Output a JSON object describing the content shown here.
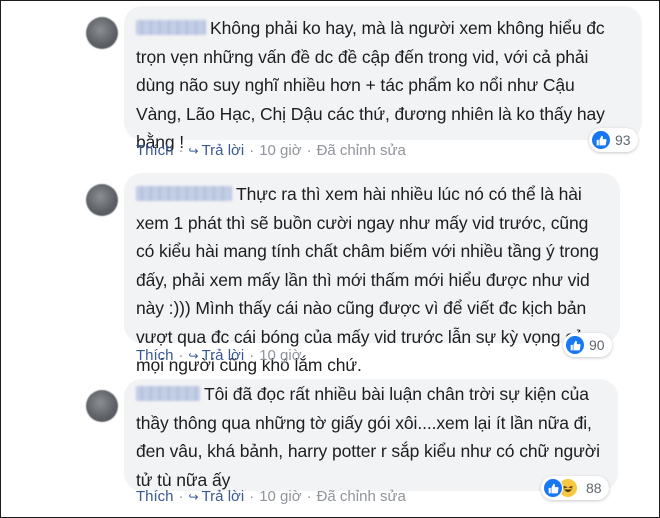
{
  "comments": [
    {
      "text": "Không phải ko hay, mà là người xem không hiểu đc\ntrọn vẹn những vấn đề dc đề cập đến trong vid, với cả phải\ndùng não suy nghĩ nhiều hơn + tác phẩm ko nổi như Cậu\nVàng, Lão Hạc, Chị Dậu các thứ, đương nhiên là ko thấy hay\nbằng !",
      "actions": {
        "like": "Thích",
        "reply": "Trả lời",
        "time": "10 giờ",
        "edited": "Đã chỉnh sửa"
      },
      "reactions": {
        "icons": [
          "like-icon"
        ],
        "count": "93"
      }
    },
    {
      "text": "Thực ra thì xem hài nhiều lúc nó có thể là hài\nxem 1 phát thì sẽ buồn cười ngay như mấy vid trước, cũng\ncó kiểu hài mang tính chất châm biếm với nhiều tầng ý trong\nđấy, phải xem mấy lần thì mới thấm mới hiểu được như vid\nnày :))) Mình thấy cái nào cũng được vì để viết đc kịch bản\nvượt qua đc cái bóng của mấy vid trước lẫn sự kỳ vọng của\nmọi người cũng khó lắm chứ.",
      "actions": {
        "like": "Thích",
        "reply": "Trả lời",
        "time": "10 giờ"
      },
      "reactions": {
        "icons": [
          "like-icon"
        ],
        "count": "90"
      }
    },
    {
      "text": "Tôi đã đọc rất nhiều bài luận chân trời sự kiện của\nthầy thông qua những tờ giấy gói xôi....xem lại ít lần nữa đi,\nđen vâu, khá bảnh, harry potter r sắp kiểu như có chữ người\ntử tù nữa ấy",
      "actions": {
        "like": "Thích",
        "reply": "Trả lời",
        "time": "10 giờ",
        "edited": "Đã chỉnh sửa"
      },
      "reactions": {
        "icons": [
          "like-icon",
          "haha-icon"
        ],
        "count": "88"
      }
    }
  ],
  "colors": {
    "bubble": "#f2f3f5",
    "action_link": "#385898",
    "meta": "#90949c",
    "like_blue": "#1877f2",
    "haha_yellow": "#f7c843"
  }
}
